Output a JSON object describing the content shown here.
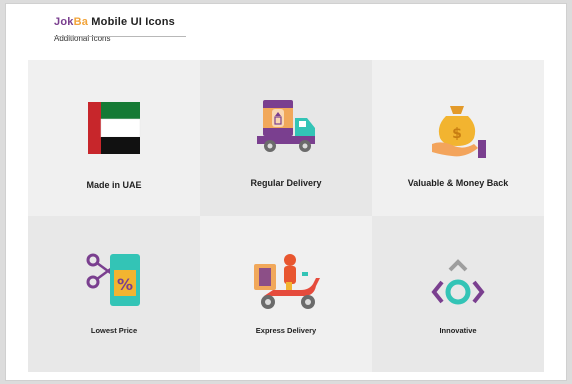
{
  "header": {
    "brand_part1": "Jok",
    "brand_part2": "Ba",
    "title_rest": " Mobile UI Icons",
    "subtitle": "Additional Icons"
  },
  "tiles": [
    {
      "label": "Made in UAE",
      "icon": "uae-flag-icon"
    },
    {
      "label": "Regular Delivery",
      "icon": "delivery-truck-icon"
    },
    {
      "label": "Valuable & Money Back",
      "icon": "money-bag-hand-icon"
    },
    {
      "label": "Lowest Price",
      "icon": "price-tag-icon"
    },
    {
      "label": "Express Delivery",
      "icon": "scooter-courier-icon"
    },
    {
      "label": "Innovative",
      "icon": "innovation-icon"
    }
  ],
  "colors": {
    "brand_purple": "#7a3f8f",
    "brand_orange": "#f2a43a",
    "teal": "#33c4b6",
    "red": "#c7262b",
    "green": "#157a35"
  }
}
